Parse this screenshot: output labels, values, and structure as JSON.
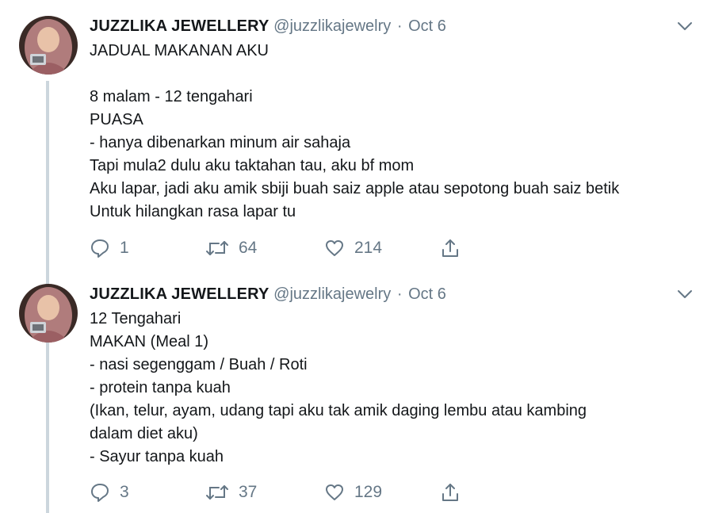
{
  "tweets": [
    {
      "name": "JUZZLIKA JEWELLERY",
      "handle": "@juzzlikajewelry",
      "separator": "·",
      "date": "Oct 6",
      "lines": [
        "JADUAL MAKANAN AKU",
        "",
        "8 malam - 12 tengahari",
        "PUASA",
        "- hanya dibenarkan minum air sahaja",
        "Tapi mula2 dulu aku taktahan tau, aku bf mom",
        "Aku lapar, jadi aku amik sbiji buah saiz apple atau sepotong buah saiz betik",
        "Untuk hilangkan rasa lapar tu"
      ],
      "replies": "1",
      "retweets": "64",
      "likes": "214"
    },
    {
      "name": "JUZZLIKA JEWELLERY",
      "handle": "@juzzlikajewelry",
      "separator": "·",
      "date": "Oct 6",
      "lines": [
        "12 Tengahari",
        "MAKAN (Meal 1)",
        "- nasi segenggam / Buah / Roti",
        "- protein tanpa kuah",
        "(Ikan, telur, ayam, udang tapi aku tak amik daging lembu atau kambing",
        "dalam diet aku)",
        "- Sayur tanpa kuah"
      ],
      "replies": "3",
      "retweets": "37",
      "likes": "129"
    }
  ],
  "icons": {
    "reply": "reply-icon",
    "retweet": "retweet-icon",
    "like": "heart-icon",
    "share": "share-icon",
    "menu": "chevron-down-icon"
  },
  "colors": {
    "text": "#14171a",
    "secondary": "#657786",
    "thread_line": "#ccd6dd"
  }
}
